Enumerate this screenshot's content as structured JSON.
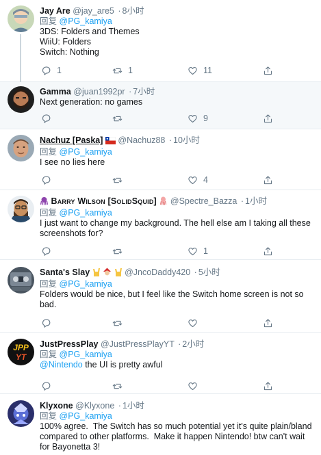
{
  "reply_prefix": "回复",
  "tweets": [
    {
      "name": "Jay Are",
      "handle": "@jay_are5",
      "time": "8小时",
      "reply_to": "@PG_kamiya",
      "text": "3DS: Folders and Themes\nWiiU: Folders\nSwitch: Nothing",
      "replies": "1",
      "retweets": "1",
      "likes": "11"
    },
    {
      "name": "Gamma",
      "handle": "@juan1992pr",
      "time": "7小时",
      "text": "Next generation: no games",
      "replies": "",
      "retweets": "",
      "likes": "9"
    },
    {
      "name": "Nachuz [Paska]",
      "handle": "@Nachuz88",
      "time": "10小时",
      "reply_to": "@PG_kamiya",
      "text": "I see no lies here",
      "replies": "",
      "retweets": "",
      "likes": "4"
    },
    {
      "name": "Barry Wilson [SolidSquid]",
      "handle": "@Spectre_Bazza",
      "time": "1小时",
      "reply_to": "@PG_kamiya",
      "text": "I just want to change my background. The hell else am I taking all these screenshots for?",
      "replies": "",
      "retweets": "",
      "likes": "1"
    },
    {
      "name": "Santa's Slay",
      "handle": "@JncoDaddy420",
      "time": "5小时",
      "reply_to": "@PG_kamiya",
      "text": "Folders would be nice, but I feel like the Switch home screen is not so bad.",
      "replies": "",
      "retweets": "",
      "likes": ""
    },
    {
      "name": "JustPressPlay",
      "handle": "@JustPressPlayYT",
      "time": "2小时",
      "reply_to": "@PG_kamiya",
      "mention": "@Nintendo",
      "text": " the UI is pretty awful",
      "replies": "",
      "retweets": "",
      "likes": ""
    },
    {
      "name": "Klyxone",
      "handle": "@Klyxone",
      "time": "1小时",
      "reply_to": "@PG_kamiya",
      "text": "100% agree.  The Switch has so much potential yet it's quite plain/bland compared to other platforms.  Make it happen Nintendo! btw can't wait for Bayonetta 3!",
      "replies": "",
      "retweets": "",
      "likes": ""
    }
  ],
  "colors": {
    "link": "#1da1f2",
    "muted": "#657786",
    "highlight_bg": "#f5f8fa",
    "divider": "#e6ecf0"
  },
  "icons": {
    "reply": "reply-icon",
    "retweet": "retweet-icon",
    "like": "heart-icon",
    "share": "share-icon"
  }
}
